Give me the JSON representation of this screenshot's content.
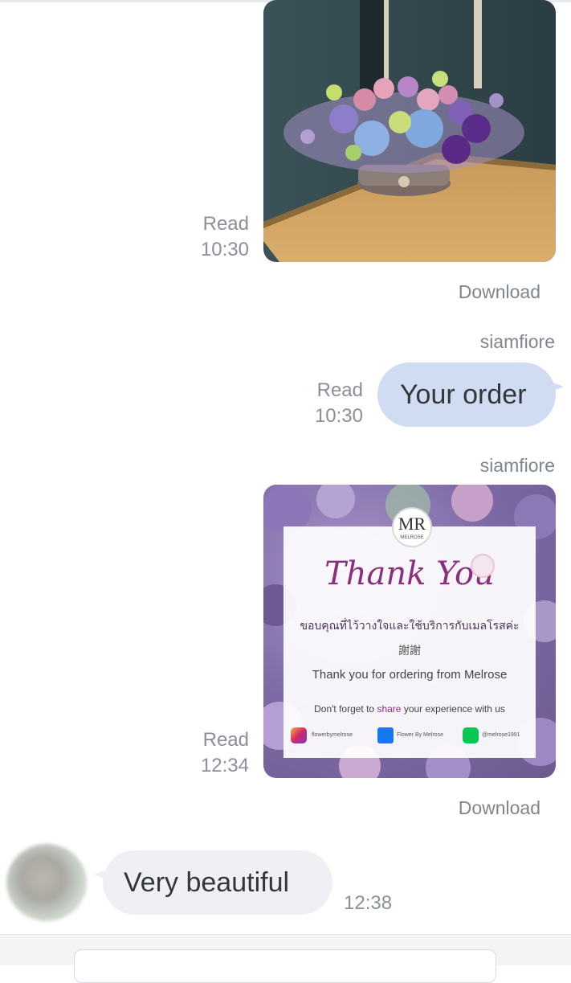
{
  "messages": [
    {
      "type": "image",
      "status": "Read",
      "time": "10:30",
      "download_label": "Download"
    },
    {
      "type": "text",
      "sender": "siamfiore",
      "status": "Read",
      "time": "10:30",
      "text": "Your order"
    },
    {
      "type": "image",
      "sender": "siamfiore",
      "status": "Read",
      "time": "12:34",
      "download_label": "Download",
      "card": {
        "logo": "MR",
        "logo_sub": "MELROSE",
        "title": "Thank You",
        "thai": "ขอบคุณที่ไว้วางใจและใช้บริการกับเมลโรสค่ะ",
        "chinese": "謝謝",
        "thanks": "Thank you for ordering from Melrose",
        "share_before": "Don't forget to ",
        "share_word": "share",
        "share_after": " your experience with us",
        "instagram": "flowerbymelrose",
        "facebook": "Flower By Melrose",
        "line": "@melrose1991"
      }
    },
    {
      "type": "text",
      "incoming": true,
      "text": "Very beautiful",
      "time": "12:38"
    }
  ],
  "colors": {
    "outgoing_bubble": "#cfdcf2",
    "incoming_bubble": "#eef0f3",
    "accent_purple": "#8a2f7e"
  }
}
